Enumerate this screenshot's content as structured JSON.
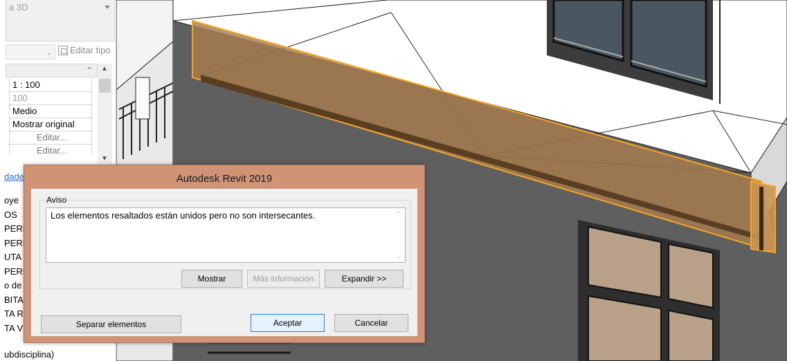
{
  "properties_panel": {
    "view_type_label": "a 3D",
    "edit_type_label": "Editar tipo",
    "rows": [
      {
        "value": "1 : 100"
      },
      {
        "value": "100"
      },
      {
        "value": "Medio"
      },
      {
        "value": "Mostrar original"
      },
      {
        "value": "Editar..."
      },
      {
        "value": "Editar..."
      }
    ],
    "help_link": "dade",
    "tree_items": [
      "oye",
      "OS",
      "PERF",
      "PERF",
      "UTA",
      "PERF",
      "o de",
      "BITA",
      "TA R",
      "TA V"
    ],
    "bottom_text": "ubdisciplina)"
  },
  "dialog": {
    "title": "Autodesk Revit 2019",
    "group_label": "Aviso",
    "message": "Los elementos resaltados están unidos pero no son intersecantes.",
    "buttons": {
      "show": "Mostrar",
      "more_info": "Más información",
      "expand": "Expandir >>",
      "unjoin": "Separar elementos",
      "ok": "Aceptar",
      "cancel": "Cancelar"
    }
  },
  "colors": {
    "dialog_frame": "#d09376",
    "highlight": "#f5a623",
    "wall": "#5f5f5f"
  }
}
